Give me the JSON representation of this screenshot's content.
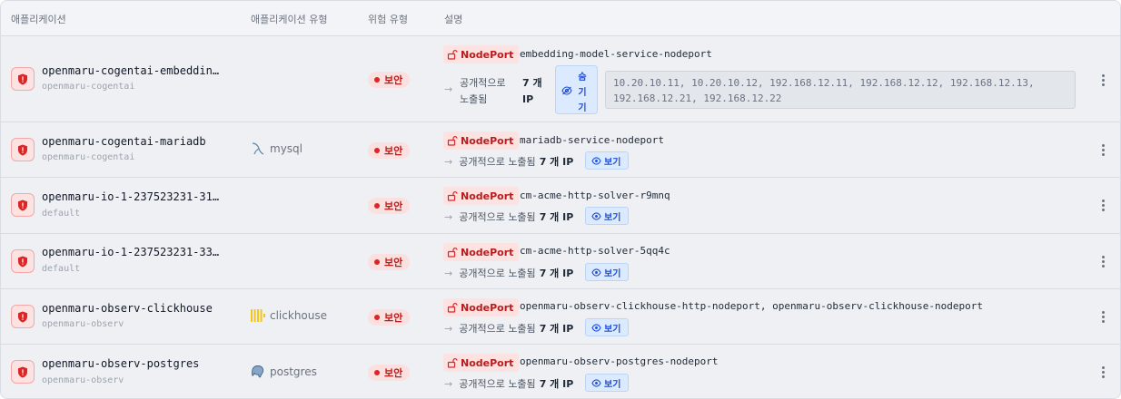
{
  "columns": {
    "application": "애플리케이션",
    "app_type": "애플리케이션 유형",
    "risk_type": "위험 유형",
    "description": "설명"
  },
  "common": {
    "risk_label": "보안",
    "nodeport_label": "NodePort",
    "exposed_label": "공개적으로 노출됨",
    "exposed_line1": "공개적으로",
    "exposed_line2": "노출됨",
    "count_label": "7 개 IP",
    "count_line1": "7 개",
    "count_line2": "IP",
    "view_label": "보기",
    "hide_chars": [
      "숨",
      "기",
      "기"
    ]
  },
  "colors": {
    "danger": "#dc2626",
    "danger_bg": "#fde2e2",
    "info": "#1d4ed8",
    "info_bg": "#dbeafe"
  },
  "rows": [
    {
      "name": "openmaru-cogentai-embeddin…",
      "namespace": "openmaru-cogentai",
      "type": "",
      "service": "embedding-model-service-nodeport",
      "ips": [
        "10.20.10.11, 10.20.10.12, 192.168.12.11, 192.168.12.12, 192.168.12.13,",
        "192.168.12.21, 192.168.12.22"
      ]
    },
    {
      "name": "openmaru-cogentai-mariadb",
      "namespace": "openmaru-cogentai",
      "type": "mysql",
      "type_icon": "mysql-dolphin-icon",
      "service": "mariadb-service-nodeport"
    },
    {
      "name": "openmaru-io-1-237523231-31…",
      "namespace": "default",
      "type": "",
      "service": "cm-acme-http-solver-r9mnq"
    },
    {
      "name": "openmaru-io-1-237523231-33…",
      "namespace": "default",
      "type": "",
      "service": "cm-acme-http-solver-5qq4c"
    },
    {
      "name": "openmaru-observ-clickhouse",
      "namespace": "openmaru-observ",
      "type": "clickhouse",
      "type_icon": "clickhouse-bars-icon",
      "service": "openmaru-observ-clickhouse-http-nodeport, openmaru-observ-clickhouse-nodeport"
    },
    {
      "name": "openmaru-observ-postgres",
      "namespace": "openmaru-observ",
      "type": "postgres",
      "type_icon": "postgres-elephant-icon",
      "service": "openmaru-observ-postgres-nodeport"
    }
  ]
}
